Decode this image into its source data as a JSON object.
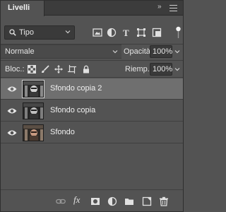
{
  "panel": {
    "tab_label": "Livelli",
    "collapse_glyph": "»",
    "menu_icon": "hamburger-icon"
  },
  "filter": {
    "kind_label": "Tipo",
    "icons": [
      "image-filter-icon",
      "adjustment-filter-icon",
      "text-filter-icon",
      "shape-filter-icon",
      "smart-object-filter-icon"
    ],
    "toggle_on": true
  },
  "blend": {
    "mode": "Normale",
    "opacity_label": "Opacità:",
    "opacity_value": "100%",
    "fill_label": "Riemp.:",
    "fill_value": "100%"
  },
  "lock": {
    "label": "Bloc.:",
    "icons": [
      "lock-transparent-pixels-icon",
      "lock-image-pixels-icon",
      "lock-position-icon",
      "lock-artboard-icon",
      "lock-all-icon"
    ]
  },
  "layers": [
    {
      "name": "Sfondo copia 2",
      "visible": true,
      "selected": true
    },
    {
      "name": "Sfondo copia",
      "visible": true,
      "selected": false
    },
    {
      "name": "Sfondo",
      "visible": true,
      "selected": false
    }
  ],
  "footer": {
    "icons": [
      "link-layers-icon",
      "layer-style-icon",
      "layer-mask-icon",
      "adjustment-layer-icon",
      "group-folder-icon",
      "new-layer-icon",
      "trash-icon"
    ],
    "fx_label": "fx"
  },
  "colors": {
    "panel_bg": "#535353",
    "selected_row": "#6f6f6f",
    "header_bg": "#3c3c3c"
  }
}
